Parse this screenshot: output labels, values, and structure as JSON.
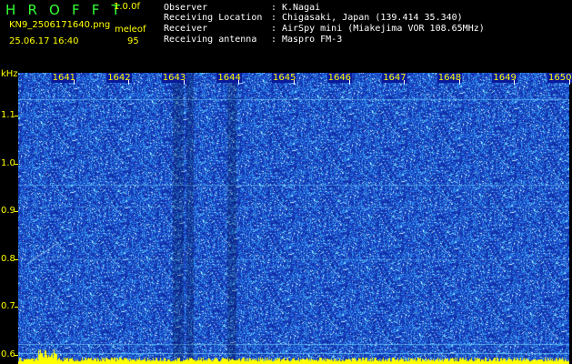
{
  "header": {
    "app_title": "H R O F F T",
    "version": "1.0.0f",
    "filename": "KN9_2506171640.png",
    "station_code": "meleof",
    "datetime": "25.06.17 16:40",
    "count": "95"
  },
  "info": [
    {
      "label": "Observer",
      "sep": ":",
      "value": "K.Nagai"
    },
    {
      "label": "Receiving Location",
      "sep": ":",
      "value": "Chigasaki, Japan (139.414 35.340)"
    },
    {
      "label": "Receiver",
      "sep": ":",
      "value": "AirSpy mini (Miakejima VOR 108.65MHz)"
    },
    {
      "label": "Receiving antenna",
      "sep": ":",
      "value": "Maspro FM-3"
    }
  ],
  "spectrogram": {
    "y_unit": "kHz",
    "y_labels": [
      "1.1",
      "1.0",
      "0.9",
      "0.8",
      "0.7",
      "0.6"
    ],
    "y_values": [
      1.1,
      1.0,
      0.9,
      0.8,
      0.7,
      0.6
    ],
    "y_range": [
      0.58,
      1.19
    ],
    "minute_labels": [
      "1641",
      "1642",
      "1643",
      "1644",
      "1645",
      "1646",
      "1647",
      "1648",
      "1649",
      "1650"
    ],
    "time_range_minutes": [
      1640,
      1650
    ],
    "colors": {
      "background": "#000000",
      "noise_low": "#0a1a8a",
      "noise_mid": "#1e50d8",
      "noise_high": "#40c8ff",
      "peak": "#ffffff",
      "bottom_level": "#ffff00",
      "label": "#ffff00",
      "title": "#33ff33"
    }
  }
}
